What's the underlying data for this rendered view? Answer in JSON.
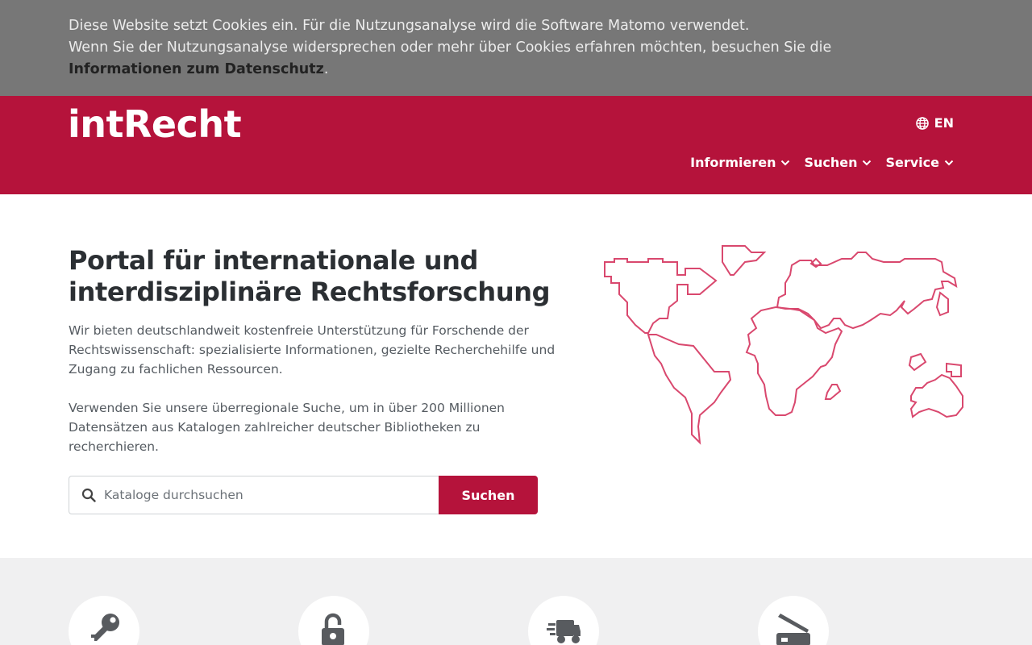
{
  "cookie": {
    "line1": "Diese Website setzt Cookies ein. Für die Nutzungsanalyse wird die Software Matomo verwendet.",
    "line2": "Wenn Sie der Nutzungsanalyse widersprechen oder mehr über Cookies erfahren möchten, besuchen Sie die",
    "link": "Informationen zum Datenschutz",
    "trailing": "."
  },
  "header": {
    "logo": "intRecht",
    "lang_label": "EN",
    "nav": [
      {
        "label": "Informieren"
      },
      {
        "label": "Suchen"
      },
      {
        "label": "Service"
      }
    ]
  },
  "hero": {
    "title": "Portal für internationale und interdisziplinäre Rechtsforschung",
    "paragraph1": "Wir bieten deutschlandweit kostenfreie Unterstützung für Forschende der Rechtswissenschaft: spezialisierte Informationen, gezielte Recherchehilfe und Zugang zu fachlichen Ressourcen.",
    "paragraph2": "Verwenden Sie unsere überregionale Suche, um in über 200 Millionen Datensätzen aus Katalogen zahlreicher deutscher Bibliotheken zu recherchieren.",
    "search_placeholder": "Kataloge durchsuchen",
    "search_value": "",
    "search_button": "Suchen"
  },
  "features": [
    {
      "icon": "key-icon"
    },
    {
      "icon": "open-lock-icon"
    },
    {
      "icon": "delivery-truck-icon"
    },
    {
      "icon": "scanner-icon"
    }
  ],
  "colors": {
    "brand": "#b5133b",
    "cookie_bg": "#777777",
    "features_bg": "#f0f0f1",
    "map_stroke": "#d9486e"
  }
}
